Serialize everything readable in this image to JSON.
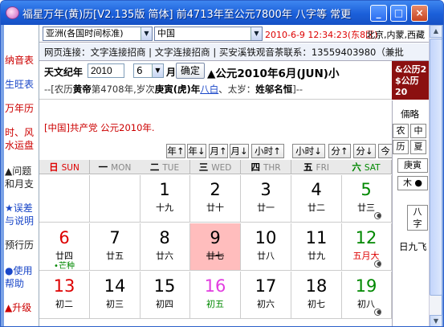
{
  "window": {
    "title": "福星万年(黄)历[V2.135版 简体] 前4713年至公元7800年 八字等 常更..."
  },
  "toolbar": {
    "timezone_select": "亚洲(各国时间标准)",
    "country_select": "中国",
    "datetime": "2010-6-9 12:34:23(东8区)",
    "place": "北京,内蒙,西藏"
  },
  "leftnav": [
    "纳音表",
    "生旺表",
    "万年历",
    "时、风",
    "水运盘",
    "▲问题",
    "和月支",
    "★误差",
    "与说明",
    "预行历",
    "●使用",
    "帮助",
    "▲升级"
  ],
  "linkbar": "网页连接：文字连接招商 | 文字连接招商 | 买安溪铁观音茶联系：13559403980（兼批",
  "yearbar": {
    "year_label": "天文纪年",
    "year_value": "2010",
    "month_value": "6",
    "month_label": "月",
    "ok_button": "确定",
    "headline": "▲公元2010年6月(JUN)小",
    "sub_prefix": "--[农历",
    "sub_huangdi": "黄帝",
    "sub_mid": "第4708年,岁次",
    "sub_gengyin": "庚寅(虎)年",
    "sub_bagua": "八白",
    "sub_taisui": "、太岁：",
    "sub_name": "姓邬名恒",
    "sub_suffix": "]--"
  },
  "sidebox": {
    "line1": "&公历2",
    "line2": "$公历20"
  },
  "infoline": "[中国]共产党 公元2010年.",
  "navbuttons": [
    "年↑",
    "年↓",
    "月↑",
    "月↓",
    "小时↑",
    "小时↓",
    "分↑",
    "分↓",
    "今"
  ],
  "weekdays": [
    {
      "zh": "日",
      "en": "SUN"
    },
    {
      "zh": "一",
      "en": "MON"
    },
    {
      "zh": "二",
      "en": "TUE"
    },
    {
      "zh": "三",
      "en": "WED"
    },
    {
      "zh": "四",
      "en": "THR"
    },
    {
      "zh": "五",
      "en": "FRI"
    },
    {
      "zh": "六",
      "en": "SAT"
    }
  ],
  "days": [
    [
      {
        "num": "",
        "lunar": ""
      },
      {
        "num": "",
        "lunar": ""
      },
      {
        "num": "1",
        "lunar": "十九"
      },
      {
        "num": "2",
        "lunar": "廿十"
      },
      {
        "num": "3",
        "lunar": "廿一"
      },
      {
        "num": "4",
        "lunar": "廿二"
      },
      {
        "num": "5",
        "lunar": "廿三",
        "style": "green",
        "moon": true
      }
    ],
    [
      {
        "num": "6",
        "lunar": "廿四",
        "term": "•芒种",
        "style": "red"
      },
      {
        "num": "7",
        "lunar": "廿五"
      },
      {
        "num": "8",
        "lunar": "廿六"
      },
      {
        "num": "9",
        "lunar": "廿七",
        "style": "today"
      },
      {
        "num": "10",
        "lunar": "廿八"
      },
      {
        "num": "11",
        "lunar": "廿九"
      },
      {
        "num": "12",
        "lunar": "五月大",
        "style": "green",
        "lunarColor": "#d00",
        "moon": true
      }
    ],
    [
      {
        "num": "13",
        "lunar": "初二",
        "style": "red"
      },
      {
        "num": "14",
        "lunar": "初三"
      },
      {
        "num": "15",
        "lunar": "初四"
      },
      {
        "num": "16",
        "lunar": "初五",
        "style": "magenta",
        "lunarColor": "#080"
      },
      {
        "num": "17",
        "lunar": "初六"
      },
      {
        "num": "18",
        "lunar": "初七"
      },
      {
        "num": "19",
        "lunar": "初八",
        "style": "green",
        "moon": true
      }
    ]
  ],
  "rpanel": {
    "r1": "倆略",
    "c1": "农",
    "c2": "中",
    "c3": "历",
    "c4": "夏",
    "r3": "庚寅",
    "r4": "木 ●",
    "r5a": "八",
    "r5b": "字",
    "r6": "日九飞"
  }
}
